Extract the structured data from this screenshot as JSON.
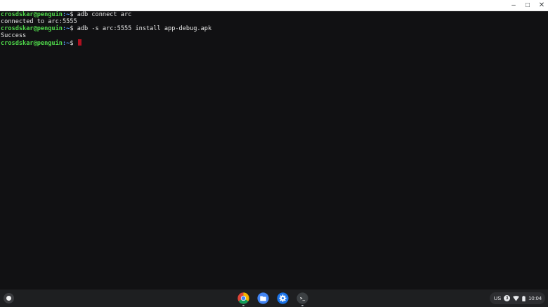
{
  "window": {
    "controls": {
      "minimize": "–",
      "maximize": "□",
      "close": "✕"
    }
  },
  "terminal": {
    "lines": [
      {
        "user": "crosdskar@penguin",
        "path": ":~",
        "prompt": "$ ",
        "cmd": "adb connect arc"
      },
      {
        "output": "connected to arc:5555"
      },
      {
        "user": "crosdskar@penguin",
        "path": ":~",
        "prompt": "$ ",
        "cmd": "adb -s arc:5555 install app-debug.apk"
      },
      {
        "output": "Success"
      },
      {
        "user": "crosdskar@penguin",
        "path": ":~",
        "prompt": "$ ",
        "cmd": ""
      }
    ],
    "colors": {
      "user": "#4fd84a",
      "path": "#5a9cff",
      "cursor": "#b01020",
      "background": "#111113"
    }
  },
  "shelf": {
    "apps": [
      {
        "name": "chrome",
        "icon": "chrome-icon"
      },
      {
        "name": "files",
        "icon": "folder-icon"
      },
      {
        "name": "settings",
        "icon": "gear-icon"
      },
      {
        "name": "terminal",
        "icon": "terminal-icon",
        "label": ">_"
      }
    ],
    "status": {
      "keyboard": "US",
      "notification_count": "3",
      "time": "10:04"
    }
  }
}
